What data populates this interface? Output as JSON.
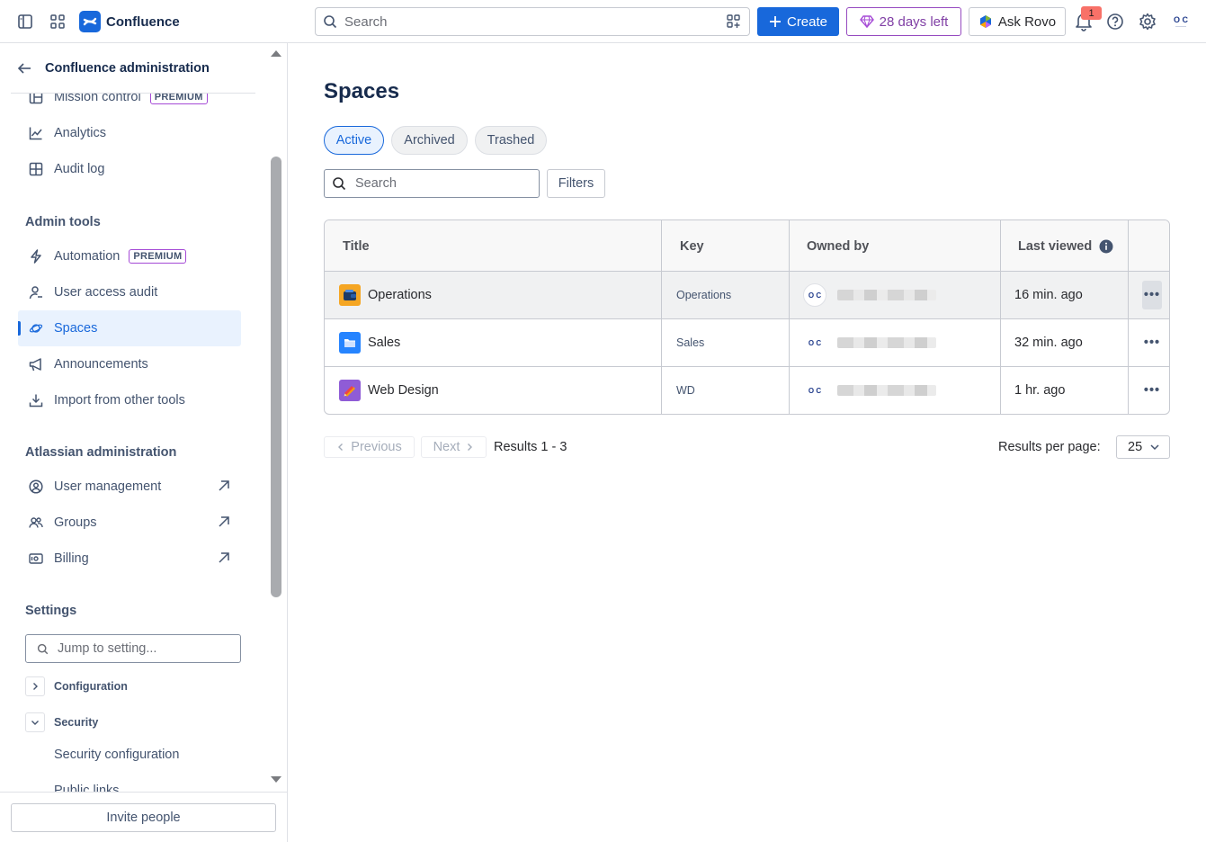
{
  "topbar": {
    "app_name": "Confluence",
    "search_placeholder": "Search",
    "create_label": "Create",
    "trial_label": "28 days left",
    "rovo_label": "Ask Rovo",
    "notification_count": "1",
    "avatar_initials": "O C"
  },
  "sidebar": {
    "header_title": "Confluence administration",
    "items_top": [
      {
        "label": "Mission control",
        "badge": "PREMIUM",
        "icon": "layout-icon"
      },
      {
        "label": "Analytics",
        "icon": "chart-icon"
      },
      {
        "label": "Audit log",
        "icon": "grid-icon"
      }
    ],
    "admin_tools_heading": "Admin tools",
    "admin_tools": [
      {
        "label": "Automation",
        "badge": "PREMIUM",
        "icon": "lightning-icon"
      },
      {
        "label": "User access audit",
        "icon": "user-audit-icon"
      },
      {
        "label": "Spaces",
        "icon": "planet-icon",
        "active": true
      },
      {
        "label": "Announcements",
        "icon": "megaphone-icon"
      },
      {
        "label": "Import from other tools",
        "icon": "download-icon"
      }
    ],
    "atlassian_heading": "Atlassian administration",
    "atlassian_items": [
      {
        "label": "User management",
        "icon": "person-circle-icon"
      },
      {
        "label": "Groups",
        "icon": "people-icon"
      },
      {
        "label": "Billing",
        "icon": "billing-icon"
      }
    ],
    "settings_heading": "Settings",
    "jump_placeholder": "Jump to setting...",
    "tree": [
      {
        "label": "Configuration",
        "expanded": false
      },
      {
        "label": "Security",
        "expanded": true
      }
    ],
    "security_children": [
      "Security configuration",
      "Public links"
    ],
    "invite_label": "Invite people"
  },
  "main": {
    "title": "Spaces",
    "tabs": [
      {
        "label": "Active",
        "active": true
      },
      {
        "label": "Archived",
        "active": false
      },
      {
        "label": "Trashed",
        "active": false
      }
    ],
    "search_placeholder": "Search",
    "filters_label": "Filters",
    "columns": [
      "Title",
      "Key",
      "Owned by",
      "Last viewed"
    ],
    "rows": [
      {
        "title": "Operations",
        "key": "Operations",
        "owner_initials": "O C",
        "last_viewed": "16 min. ago",
        "icon_color": "#f5a623"
      },
      {
        "title": "Sales",
        "key": "Sales",
        "owner_initials": "O C",
        "last_viewed": "32 min. ago",
        "icon_color": "#2684ff"
      },
      {
        "title": "Web Design",
        "key": "WD",
        "owner_initials": "O C",
        "last_viewed": "1 hr. ago",
        "icon_color": "#8f5cd6"
      }
    ],
    "pager": {
      "previous_label": "Previous",
      "next_label": "Next",
      "results_text": "Results 1 - 3",
      "rpp_label": "Results per page:",
      "rpp_value": "25"
    }
  },
  "colors": {
    "brand": "#1868db",
    "premium": "#a54ad6",
    "trial": "#803fa5",
    "notification": "#f87168"
  }
}
